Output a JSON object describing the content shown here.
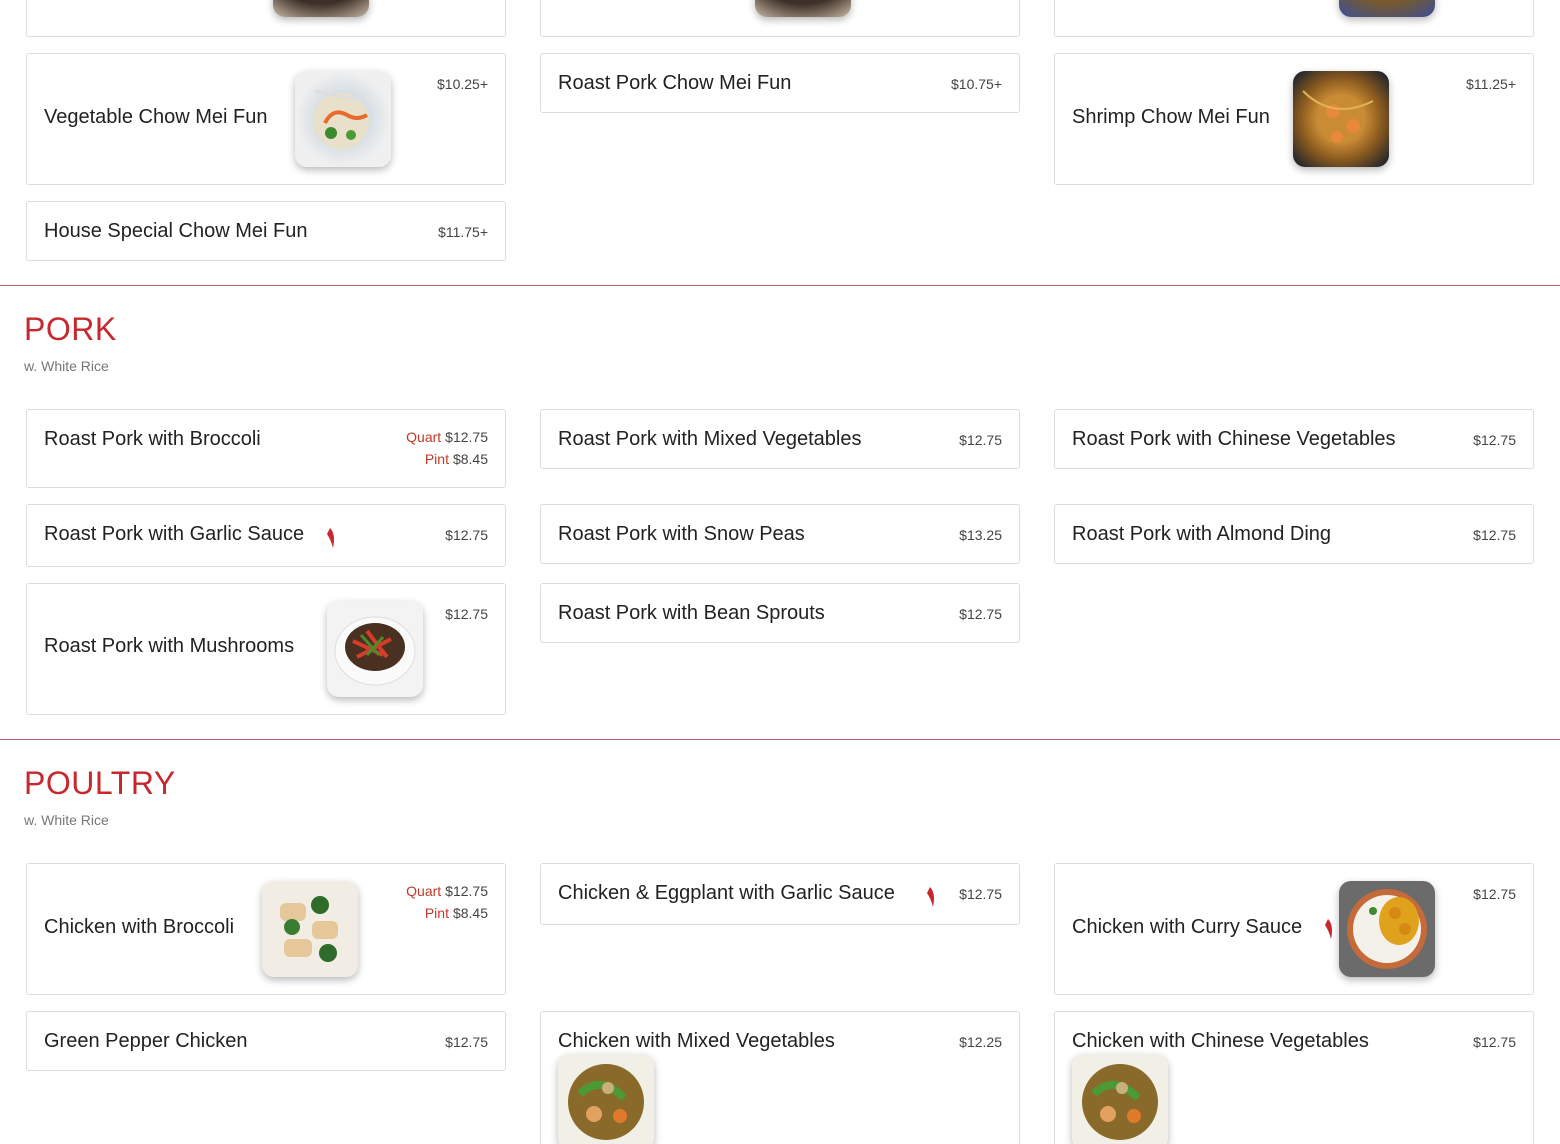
{
  "top_row_cut": {},
  "chow_mei_fun": {
    "items": [
      {
        "name": "Vegetable Chow Mei Fun",
        "price": "$10.25+"
      },
      {
        "name": "Roast Pork Chow Mei Fun",
        "price": "$10.75+"
      },
      {
        "name": "Shrimp Chow Mei Fun",
        "price": "$11.25+"
      },
      {
        "name": "House Special Chow Mei Fun",
        "price": "$11.75+"
      }
    ]
  },
  "pork": {
    "title": "PORK",
    "subtitle": "w. White Rice",
    "items": [
      {
        "name": "Roast Pork with Broccoli",
        "quart_label": "Quart",
        "quart_price": "$12.75",
        "pint_label": "Pint",
        "pint_price": "$8.45"
      },
      {
        "name": "Roast Pork with Mixed Vegetables",
        "price": "$12.75"
      },
      {
        "name": "Roast Pork with Chinese Vegetables",
        "price": "$12.75"
      },
      {
        "name": "Roast Pork with Garlic Sauce",
        "price": "$12.75",
        "spicy": true
      },
      {
        "name": "Roast Pork with Snow Peas",
        "price": "$13.25"
      },
      {
        "name": "Roast Pork with Almond Ding",
        "price": "$12.75"
      },
      {
        "name": "Roast Pork with Mushrooms",
        "price": "$12.75"
      },
      {
        "name": "Roast Pork with Bean Sprouts",
        "price": "$12.75"
      }
    ]
  },
  "poultry": {
    "title": "POULTRY",
    "subtitle": "w. White Rice",
    "items": [
      {
        "name": "Chicken with Broccoli",
        "quart_label": "Quart",
        "quart_price": "$12.75",
        "pint_label": "Pint",
        "pint_price": "$8.45"
      },
      {
        "name": "Chicken & Eggplant with Garlic Sauce",
        "price": "$12.75",
        "spicy": true
      },
      {
        "name": "Chicken with Curry Sauce",
        "price": "$12.75",
        "spicy": true
      },
      {
        "name": "Green Pepper Chicken",
        "price": "$12.75"
      },
      {
        "name": "Chicken with Mixed Vegetables",
        "price": "$12.25"
      },
      {
        "name": "Chicken with Chinese Vegetables",
        "price": "$12.75"
      }
    ]
  },
  "icons": {
    "spicy": "chili-pepper-icon"
  },
  "colors": {
    "accent": "#c7282e",
    "rule": "#b46a6a"
  }
}
